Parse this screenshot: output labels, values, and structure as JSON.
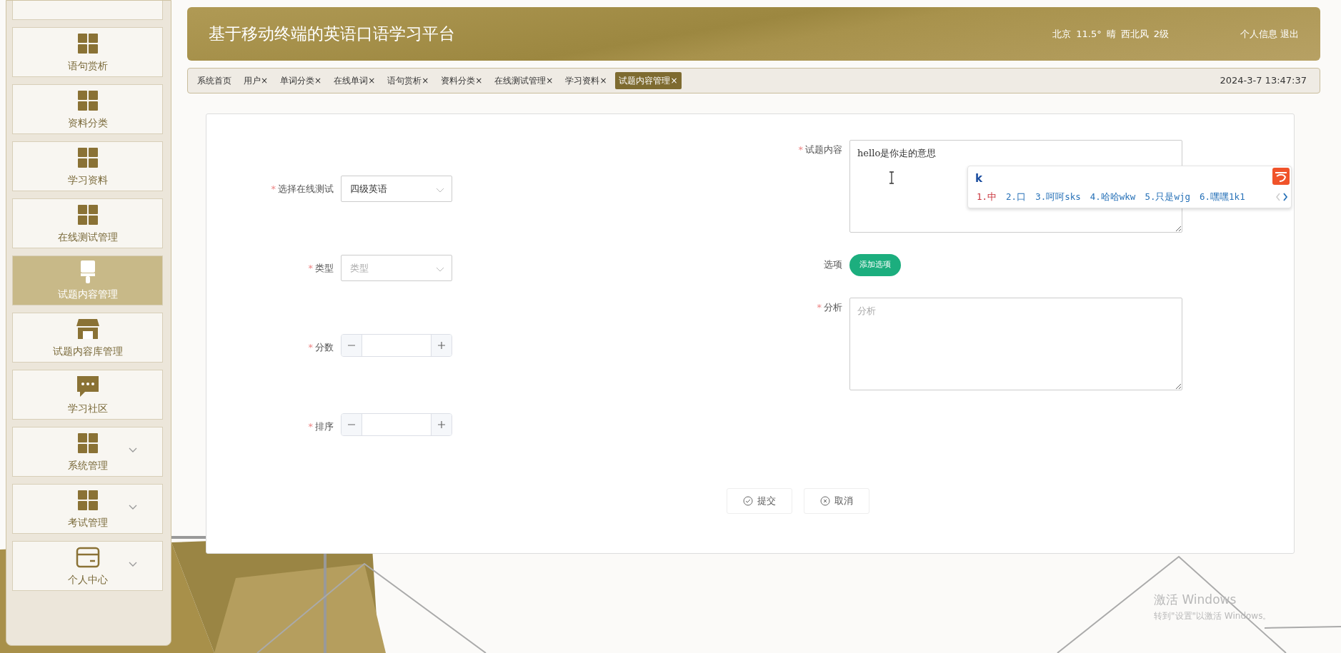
{
  "sidebar": {
    "items": [
      {
        "kind": "cut",
        "selected": false
      },
      {
        "label": "语句赏析",
        "kind": "grid",
        "selected": false,
        "expandable": false
      },
      {
        "label": "资料分类",
        "kind": "grid",
        "selected": false,
        "expandable": false
      },
      {
        "label": "学习资料",
        "kind": "grid",
        "selected": false,
        "expandable": false
      },
      {
        "label": "在线测试管理",
        "kind": "grid",
        "selected": false,
        "expandable": false
      },
      {
        "label": "试题内容管理",
        "kind": "brush",
        "selected": true,
        "expandable": false
      },
      {
        "label": "试题内容库管理",
        "kind": "store",
        "selected": false,
        "expandable": false
      },
      {
        "label": "学习社区",
        "kind": "chat",
        "selected": false,
        "expandable": false
      },
      {
        "label": "系统管理",
        "kind": "grid",
        "selected": false,
        "expandable": true
      },
      {
        "label": "考试管理",
        "kind": "grid",
        "selected": false,
        "expandable": true
      },
      {
        "label": "个人中心",
        "kind": "card",
        "selected": false,
        "expandable": true
      }
    ]
  },
  "header": {
    "title": "基于移动终端的英语口语学习平台",
    "weather": [
      "北京",
      "11.5°",
      "晴",
      "西北风",
      "2级"
    ],
    "links": [
      "个人信息",
      "退出"
    ]
  },
  "tabs": [
    {
      "label": "系统首页",
      "selected": false
    },
    {
      "label": "用户",
      "close": "×",
      "selected": false
    },
    {
      "label": "单词分类",
      "close": "×",
      "selected": false
    },
    {
      "label": "在线单词",
      "close": "×",
      "selected": false
    },
    {
      "label": "语句赏析",
      "close": "×",
      "selected": false
    },
    {
      "label": "资料分类",
      "close": "×",
      "selected": false
    },
    {
      "label": "在线测试管理",
      "close": "×",
      "selected": false
    },
    {
      "label": "学习资料",
      "close": "×",
      "selected": false
    },
    {
      "label": "试题内容管理",
      "close": "×",
      "selected": true
    }
  ],
  "datetime": "2024-3-7 13:47:37",
  "form": {
    "left": [
      {
        "required_mark": "*",
        "label": "选择在线测试",
        "kind": "select",
        "value": "四级英语"
      },
      {
        "required_mark": "*",
        "label": "类型",
        "kind": "select",
        "placeholder": "类型"
      },
      {
        "required_mark": "*",
        "label": "分数",
        "kind": "number"
      },
      {
        "required_mark": "*",
        "label": "排序",
        "kind": "number"
      }
    ],
    "right": [
      {
        "required_mark": "*",
        "label": "试题内容",
        "kind": "textarea",
        "value": "hello是你走的意思"
      },
      {
        "label": "选项",
        "kind": "button",
        "button": "添加选项"
      },
      {
        "required_mark": "*",
        "label": "分析",
        "kind": "textarea",
        "placeholder": "分析"
      }
    ],
    "actions": [
      {
        "label": "提交",
        "kind": "submit"
      },
      {
        "label": "取消",
        "kind": "cancel"
      }
    ]
  },
  "ime": {
    "input": "k",
    "candidates": [
      {
        "label": "1.中",
        "selected": true
      },
      {
        "label": "2.口",
        "selected": false
      },
      {
        "label": "3.呵呵sks",
        "selected": false
      },
      {
        "label": "4.哈哈wkw",
        "selected": false
      },
      {
        "label": "5.只是wjg",
        "selected": false
      },
      {
        "label": "6.嘿嘿1k1",
        "selected": false
      }
    ]
  },
  "os_notice": [
    "激活 Windows",
    "转到\"设置\"以激活 Windows。"
  ]
}
